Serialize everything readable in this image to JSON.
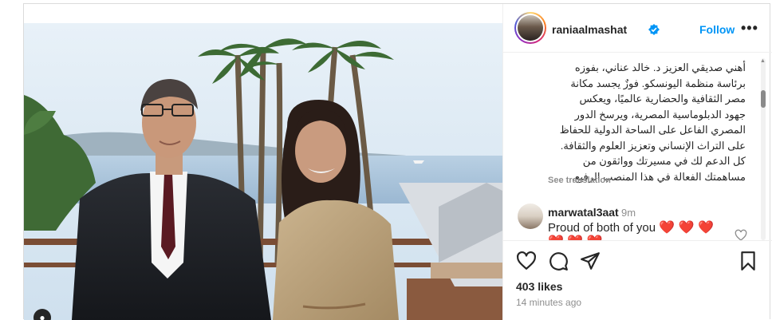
{
  "post": {
    "username": "raniaalmashat",
    "follow_label": "Follow",
    "more_label": "•••",
    "caption": "أهني صديقي العزيز د. خالد عناني، بفوزه\nبرئاسة منظمة اليونسكو. فوزٌ يجسد مكانة\nمصر الثقافية والحضارية عالميًا، ويعكس\nجهود الدبلوماسية المصرية، ويرسخ الدور\nالمصري الفاعل على الساحة الدولية للحفاظ\nعلى التراث الإنساني وتعزيز العلوم والثقافة.\nكل الدعم لك في مسيرتك وواثقون من\nمساهمتك الفعالة في هذا المنصب الرفيع.",
    "see_translation": "See translation",
    "likes": "403 likes",
    "time_ago": "14 minutes ago"
  },
  "comment": {
    "username": "marwatal3aat",
    "time": "9m",
    "text": "Proud of both of you",
    "hearts_line1": "❤️ ❤️ ❤️",
    "hearts_line2": "❤️ ❤️ ❤️"
  },
  "icons": {
    "verified": "verified-badge-icon",
    "like": "heart-outline-icon",
    "comment": "comment-bubble-icon",
    "share": "paper-plane-icon",
    "save": "bookmark-icon"
  },
  "colors": {
    "accent": "#0095f6",
    "text": "#262626",
    "muted": "#8e8e8e",
    "heart": "#ed1c24"
  }
}
